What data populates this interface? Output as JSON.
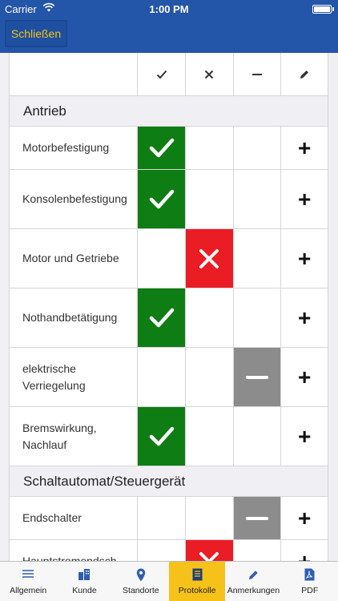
{
  "status_bar": {
    "carrier": "Carrier",
    "time": "1:00 PM"
  },
  "nav": {
    "close_label": "Schließen"
  },
  "columns": {
    "ok": "✓",
    "fail": "✕",
    "na": "−",
    "note": "pencil-icon"
  },
  "colors": {
    "ok": "#0e7d14",
    "fail": "#ea1c24",
    "na": "#8c8c8c",
    "nav": "#2355a8",
    "accent": "#f6c21a"
  },
  "sections": [
    {
      "title": "Antrieb",
      "rows": [
        {
          "label": "Motorbefestigung",
          "status": "ok",
          "action": "+"
        },
        {
          "label": "Konsolenbefestigung",
          "status": "ok",
          "action": "+"
        },
        {
          "label": "Motor und Getriebe",
          "status": "fail",
          "action": "+"
        },
        {
          "label": "Nothandbetätigung",
          "status": "ok",
          "action": "+"
        },
        {
          "label": "elektrische Verriegelung",
          "status": "na",
          "action": "+"
        },
        {
          "label": "Bremswirkung, Nachlauf",
          "status": "ok",
          "action": "+"
        }
      ]
    },
    {
      "title": "Schaltautomat/Steuergerät",
      "rows": [
        {
          "label": "Endschalter",
          "status": "na",
          "action": "+"
        },
        {
          "label": "Hauptstromendsch",
          "status": "fail",
          "action": "+"
        }
      ]
    }
  ],
  "tabs": [
    {
      "label": "Allgemein",
      "icon": "list-icon",
      "active": false
    },
    {
      "label": "Kunde",
      "icon": "building-icon",
      "active": false
    },
    {
      "label": "Standorte",
      "icon": "location-pin-icon",
      "active": false
    },
    {
      "label": "Protokolle",
      "icon": "document-icon",
      "active": true
    },
    {
      "label": "Anmerkungen",
      "icon": "pencil-icon",
      "active": false
    },
    {
      "label": "PDF",
      "icon": "pdf-icon",
      "active": false
    }
  ]
}
